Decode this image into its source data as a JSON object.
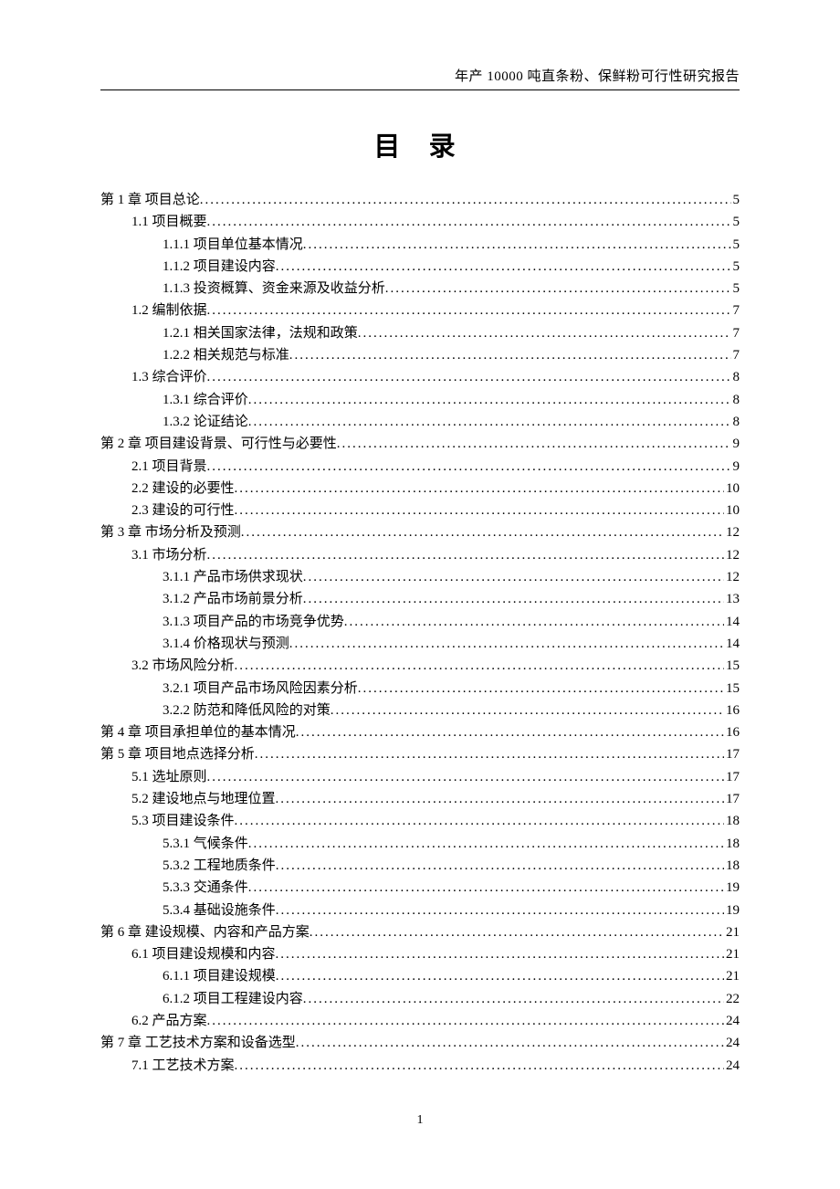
{
  "header": "年产 10000 吨直条粉、保鲜粉可行性研究报告",
  "title": "目 录",
  "page_number": "1",
  "toc": [
    {
      "level": 0,
      "label": "第 1 章  项目总论",
      "page": "5"
    },
    {
      "level": 1,
      "label": "1.1 项目概要",
      "page": "5"
    },
    {
      "level": 2,
      "label": "1.1.1 项目单位基本情况",
      "page": "5"
    },
    {
      "level": 2,
      "label": "1.1.2 项目建设内容",
      "page": "5"
    },
    {
      "level": 2,
      "label": "1.1.3 投资概算、资金来源及收益分析",
      "page": "5"
    },
    {
      "level": 1,
      "label": "1.2 编制依据",
      "page": "7"
    },
    {
      "level": 2,
      "label": "1.2.1 相关国家法律，法规和政策",
      "page": "7"
    },
    {
      "level": 2,
      "label": "1.2.2 相关规范与标准",
      "page": "7"
    },
    {
      "level": 1,
      "label": "1.3 综合评价",
      "page": "8"
    },
    {
      "level": 2,
      "label": "1.3.1 综合评价",
      "page": "8"
    },
    {
      "level": 2,
      "label": "1.3.2 论证结论",
      "page": "8"
    },
    {
      "level": 0,
      "label": "第 2 章  项目建设背景、可行性与必要性",
      "page": "9"
    },
    {
      "level": 1,
      "label": "2.1 项目背景",
      "page": "9"
    },
    {
      "level": 1,
      "label": "2.2 建设的必要性",
      "page": "10"
    },
    {
      "level": 1,
      "label": "2.3 建设的可行性",
      "page": "10"
    },
    {
      "level": 0,
      "label": "第 3 章  市场分析及预测",
      "page": "12"
    },
    {
      "level": 1,
      "label": "3.1 市场分析",
      "page": "12"
    },
    {
      "level": 2,
      "label": "3.1.1 产品市场供求现状",
      "page": "12"
    },
    {
      "level": 2,
      "label": "3.1.2 产品市场前景分析",
      "page": "13"
    },
    {
      "level": 2,
      "label": "3.1.3 项目产品的市场竞争优势",
      "page": "14"
    },
    {
      "level": 2,
      "label": "3.1.4 价格现状与预测",
      "page": "14"
    },
    {
      "level": 1,
      "label": "3.2 市场风险分析",
      "page": "15"
    },
    {
      "level": 2,
      "label": "3.2.1 项目产品市场风险因素分析",
      "page": "15"
    },
    {
      "level": 2,
      "label": "3.2.2 防范和降低风险的对策",
      "page": "16"
    },
    {
      "level": 0,
      "label": "第 4 章  项目承担单位的基本情况",
      "page": "16"
    },
    {
      "level": 0,
      "label": "第 5 章  项目地点选择分析",
      "page": "17"
    },
    {
      "level": 1,
      "label": "5.1  选址原则",
      "page": "17"
    },
    {
      "level": 1,
      "label": "5.2  建设地点与地理位置",
      "page": "17"
    },
    {
      "level": 1,
      "label": "5.3  项目建设条件",
      "page": "18"
    },
    {
      "level": 2,
      "label": "5.3.1  气候条件",
      "page": "18"
    },
    {
      "level": 2,
      "label": "5.3.2  工程地质条件",
      "page": "18"
    },
    {
      "level": 2,
      "label": "5.3.3  交通条件",
      "page": "19"
    },
    {
      "level": 2,
      "label": "5.3.4  基础设施条件",
      "page": "19"
    },
    {
      "level": 0,
      "label": "第 6 章  建设规模、内容和产品方案",
      "page": "21"
    },
    {
      "level": 1,
      "label": "6.1  项目建设规模和内容",
      "page": "21"
    },
    {
      "level": 2,
      "label": "6.1.1  项目建设规模",
      "page": "21"
    },
    {
      "level": 2,
      "label": "6.1.2  项目工程建设内容",
      "page": "22"
    },
    {
      "level": 1,
      "label": "6.2  产品方案",
      "page": "24"
    },
    {
      "level": 0,
      "label": "第 7 章  工艺技术方案和设备选型",
      "page": "24"
    },
    {
      "level": 1,
      "label": "7.1  工艺技术方案",
      "page": "24"
    }
  ]
}
